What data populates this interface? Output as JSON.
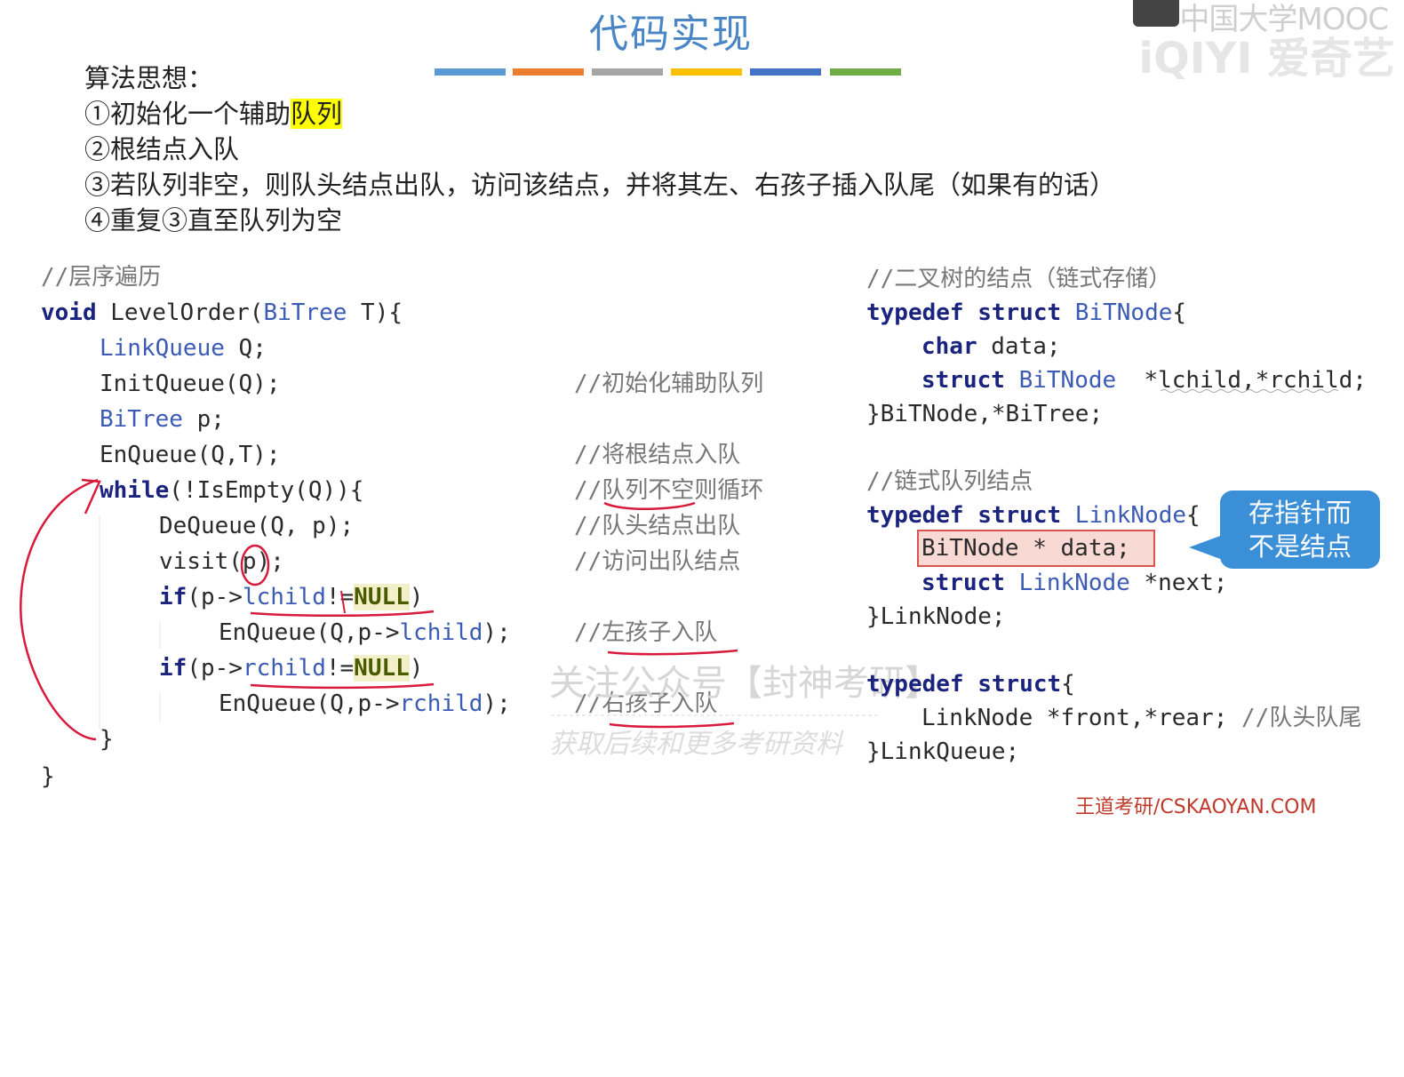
{
  "title": "代码实现",
  "title_bar_colors": [
    "#5b9bd5",
    "#ed7d31",
    "#a5a5a5",
    "#ffc000",
    "#4472c4",
    "#70ad47"
  ],
  "watermark": {
    "top_line": "中国大学MOOC",
    "second_line": "iQIYI 爱奇艺",
    "center_line1": "关注公众号【封神考研】",
    "center_line2": "获取后续和更多考研资料",
    "footer": "王道考研/CSKAOYAN.COM"
  },
  "algorithm": {
    "heading": "算法思想：",
    "step1_prefix": "①初始化一个辅助",
    "step1_highlight": "队列",
    "step2": "②根结点入队",
    "step3": "③若队列非空，则队头结点出队，访问该结点，并将其左、右孩子插入队尾（如果有的话）",
    "step4": "④重复③直至队列为空"
  },
  "left_code": {
    "comment_header": "//层序遍历",
    "l1_kw": "void",
    "l1_rest1": " LevelOrder(",
    "l1_type": "BiTree",
    "l1_rest2": " T){",
    "l2_type": "LinkQueue",
    "l2_rest": " Q;",
    "l3": "InitQueue(Q);",
    "l3_comment": "//初始化辅助队列",
    "l4_type": "BiTree",
    "l4_rest": " p;",
    "l5": "EnQueue(Q,T);",
    "l5_comment": "//将根结点入队",
    "l6_kw": "while",
    "l6_rest": "(!IsEmpty(Q)){",
    "l6_comment": "//队列不空则循环",
    "l7": "DeQueue(Q, p);",
    "l7_comment": "//队头结点出队",
    "l8": "visit(p);",
    "l8_comment": "//访问出队结点",
    "l9_kw": "if",
    "l9_a": "(p->",
    "l9_b": "lchild",
    "l9_c": "!=",
    "l9_d": "NULL",
    "l9_e": ")",
    "l10": "EnQueue(Q,p->",
    "l10_b": "lchild",
    "l10_c": ");",
    "l10_comment": "//左孩子入队",
    "l11_kw": "if",
    "l11_a": "(p->",
    "l11_b": "rchild",
    "l11_c": "!=",
    "l11_d": "NULL",
    "l11_e": ")",
    "l12": "EnQueue(Q,p->",
    "l12_b": "rchild",
    "l12_c": ");",
    "l12_comment": "//右孩子入队",
    "l13": "}",
    "l14": "}"
  },
  "right_code": {
    "c1": "//二叉树的结点（链式存储）",
    "r1_kw": "typedef struct",
    "r1_type": " BiTNode",
    "r1_rest": "{",
    "r2_kw": "char",
    "r2_rest": " data;",
    "r3_kw": "struct",
    "r3_type": " BiTNode",
    "r3_rest": "  *lchild,*rchild;",
    "r4": "}BiTNode,*BiTree;",
    "c2": "//链式队列结点",
    "r5_kw": "typedef struct",
    "r5_type": " LinkNode",
    "r5_rest": "{",
    "r6": "BiTNode * data;",
    "r7_kw": "struct",
    "r7_type": " LinkNode",
    "r7_rest": " *next;",
    "r8": "}LinkNode;",
    "r9_kw": "typedef struct",
    "r9_rest": "{",
    "r10": "LinkNode *front,*rear;",
    "r10_comment": " //队头队尾",
    "r11": "}LinkQueue;"
  },
  "callout": {
    "line1": "存指针而",
    "line2": "不是结点"
  }
}
